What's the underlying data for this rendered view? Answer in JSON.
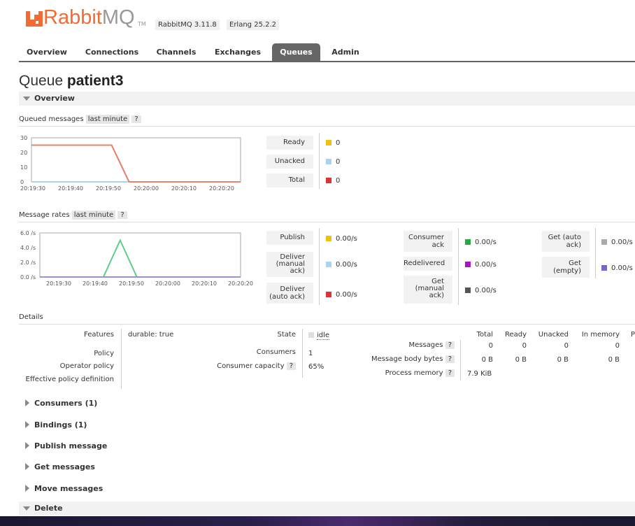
{
  "header": {
    "logo_main": "Rabbit",
    "logo_mq": "MQ",
    "logo_tm": "TM",
    "version": "RabbitMQ 3.11.8",
    "erlang": "Erlang 25.2.2"
  },
  "nav": {
    "tabs": [
      "Overview",
      "Connections",
      "Channels",
      "Exchanges",
      "Queues",
      "Admin"
    ],
    "active": "Queues"
  },
  "page": {
    "title_prefix": "Queue",
    "queue_name": "patient3"
  },
  "sections": {
    "overview": "Overview",
    "queued_messages": "Queued messages",
    "message_rates": "Message rates",
    "range": "last minute",
    "help": "?",
    "details": "Details"
  },
  "queued_chart": {
    "y_ticks": [
      "30",
      "20",
      "10",
      "0"
    ],
    "x_ticks": [
      "20:19:30",
      "20:19:40",
      "20:19:50",
      "20:20:00",
      "20:20:10",
      "20:20:20"
    ],
    "legend": [
      {
        "label": "Ready",
        "value": "0",
        "color": "#f0c010"
      },
      {
        "label": "Unacked",
        "value": "0",
        "color": "#a8d4f0"
      },
      {
        "label": "Total",
        "value": "0",
        "color": "#dd3333"
      }
    ]
  },
  "rates_chart": {
    "y_ticks": [
      "6.0 /s",
      "4.0 /s",
      "2.0 /s",
      "0.0 /s"
    ],
    "x_ticks": [
      "20:19:30",
      "20:19:40",
      "20:19:50",
      "20:20:00",
      "20:20:10",
      "20:20:20"
    ],
    "legend": [
      {
        "label": "Publish",
        "value": "0.00/s",
        "color": "#f0c010"
      },
      {
        "label": "Deliver (manual ack)",
        "value": "0.00/s",
        "color": "#a8d4f0"
      },
      {
        "label": "Deliver (auto ack)",
        "value": "0.00/s",
        "color": "#dd3333"
      },
      {
        "label": "Consumer ack",
        "value": "0.00/s",
        "color": "#22aa44"
      },
      {
        "label": "Redelivered",
        "value": "0.00/s",
        "color": "#aa11cc"
      },
      {
        "label": "Get (manual ack)",
        "value": "0.00/s",
        "color": "#555555"
      },
      {
        "label": "Get (auto ack)",
        "value": "0.00/s",
        "color": "#aaaaaa"
      },
      {
        "label": "Get (empty)",
        "value": "0.00/s",
        "color": "#7766cc"
      }
    ]
  },
  "chart_data": [
    {
      "type": "line",
      "x": [
        "20:19:30",
        "20:19:40",
        "20:19:50",
        "20:20:00",
        "20:20:10",
        "20:20:20"
      ],
      "ylim": [
        0,
        30
      ],
      "series": [
        {
          "name": "Ready",
          "points": [
            [
              0,
              25
            ],
            [
              23,
              25
            ],
            [
              28,
              0
            ],
            [
              60,
              0
            ]
          ]
        },
        {
          "name": "Unacked",
          "points": [
            [
              0,
              0
            ],
            [
              60,
              0
            ]
          ]
        },
        {
          "name": "Total",
          "points": [
            [
              0,
              25
            ],
            [
              23,
              25
            ],
            [
              28,
              0
            ],
            [
              60,
              0
            ]
          ]
        }
      ]
    },
    {
      "type": "line",
      "x": [
        "20:19:30",
        "20:19:40",
        "20:19:50",
        "20:20:00",
        "20:20:10",
        "20:20:20"
      ],
      "ylim": [
        0,
        6
      ],
      "series": [
        {
          "name": "Consumer ack",
          "points": [
            [
              0,
              0
            ],
            [
              19,
              0
            ],
            [
              24,
              5
            ],
            [
              29,
              0
            ],
            [
              60,
              0
            ]
          ]
        },
        {
          "name": "Get (empty)",
          "points": [
            [
              0,
              0
            ],
            [
              60,
              0
            ]
          ]
        }
      ]
    }
  ],
  "details": {
    "features_label": "Features",
    "durable_key": "durable:",
    "durable_val": "true",
    "policy_label": "Policy",
    "operator_policy_label": "Operator policy",
    "effective_policy_label": "Effective policy definition",
    "state_label": "State",
    "state_val": "idle",
    "consumers_label": "Consumers",
    "consumers_val": "1",
    "capacity_label": "Consumer capacity",
    "capacity_val": "65%",
    "cols": [
      "Total",
      "Ready",
      "Unacked",
      "In memory",
      "P"
    ],
    "messages_label": "Messages",
    "messages_vals": [
      "0",
      "0",
      "0",
      "0"
    ],
    "body_bytes_label": "Message body bytes",
    "body_bytes_vals": [
      "0 B",
      "0 B",
      "0 B",
      "0 B"
    ],
    "process_memory_label": "Process memory",
    "process_memory_val": "7.9 KiB"
  },
  "collapsibles": [
    "Consumers (1)",
    "Bindings (1)",
    "Publish message",
    "Get messages",
    "Move messages",
    "Delete"
  ]
}
